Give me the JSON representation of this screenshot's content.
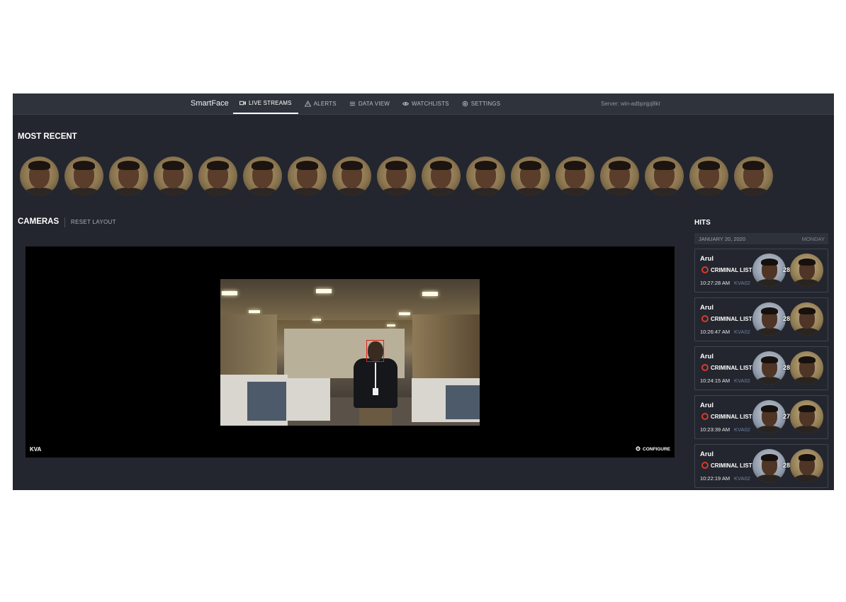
{
  "brand": "SmartFace",
  "nav": [
    {
      "label": "LIVE STREAMS",
      "icon": "video-camera-icon",
      "active": true
    },
    {
      "label": "ALERTS",
      "icon": "warning-triangle-icon",
      "active": false
    },
    {
      "label": "DATA VIEW",
      "icon": "list-icon",
      "active": false
    },
    {
      "label": "WATCHLISTS",
      "icon": "eye-icon",
      "active": false
    },
    {
      "label": "SETTINGS",
      "icon": "gear-icon",
      "active": false
    }
  ],
  "server": "Server: win-adbpnjpj8kt",
  "most_recent": {
    "title": "MOST RECENT",
    "face_count": 17
  },
  "cameras": {
    "title": "CAMERAS",
    "reset_label": "RESET LAYOUT",
    "stream_label": "KVA",
    "configure_label": "CONFIGURE"
  },
  "hits": {
    "title": "HITS",
    "date": "JANUARY 20, 2020",
    "weekday": "MONDAY",
    "items": [
      {
        "name": "Arul",
        "list": "CRIMINAL LIST",
        "time": "10:27:28 AM",
        "camera": "KVA02",
        "score": "28"
      },
      {
        "name": "Arul",
        "list": "CRIMINAL LIST",
        "time": "10:26:47 AM",
        "camera": "KVA02",
        "score": "28"
      },
      {
        "name": "Arul",
        "list": "CRIMINAL LIST",
        "time": "10:24:15 AM",
        "camera": "KVA02",
        "score": "28"
      },
      {
        "name": "Arul",
        "list": "CRIMINAL LIST",
        "time": "10:23:39 AM",
        "camera": "KVA02",
        "score": "27"
      },
      {
        "name": "Arul",
        "list": "CRIMINAL LIST",
        "time": "10:22:19 AM",
        "camera": "KVA02",
        "score": "28"
      }
    ]
  },
  "colors": {
    "background": "#23262e",
    "topbar": "#2f333b",
    "watchlist_ring": "#d63a2f",
    "face_box": "#e0201c",
    "camera_text": "#6f7fa8"
  }
}
